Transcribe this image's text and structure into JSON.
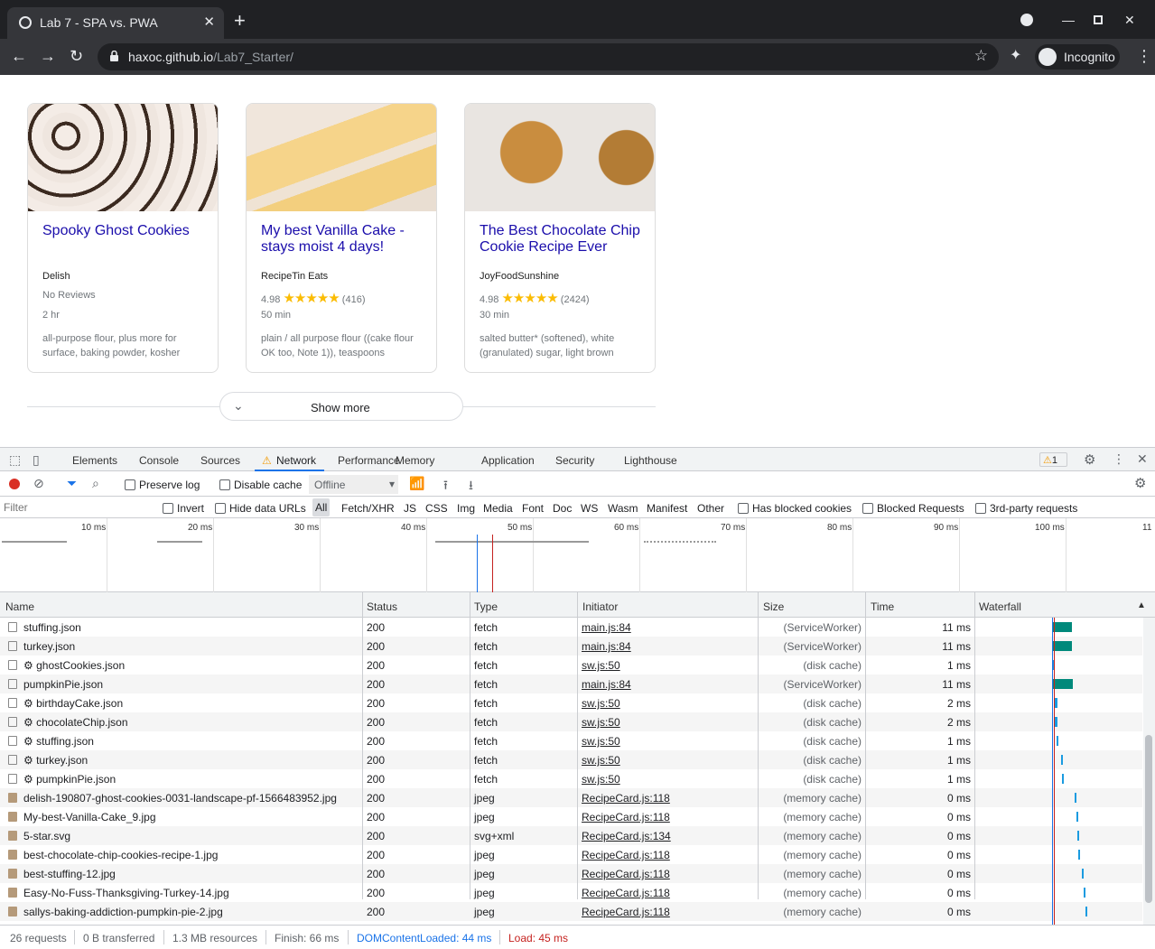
{
  "browser": {
    "tab_title": "Lab 7 - SPA vs. PWA",
    "url_host": "haxoc.github.io",
    "url_path": "/Lab7_Starter/",
    "incognito_label": "Incognito"
  },
  "page": {
    "cards": [
      {
        "title": "Spooky Ghost Cookies",
        "org": "Delish",
        "rating": "No Reviews",
        "stars": "",
        "count": "",
        "time": "2 hr",
        "ingredients": "all-purpose flour, plus more for surface, baking powder, kosher"
      },
      {
        "title": "My best Vanilla Cake - stays moist 4 days!",
        "org": "RecipeTin Eats",
        "rating": "4.98",
        "stars": "★★★★★",
        "count": "(416)",
        "time": "50 min",
        "ingredients": "plain / all purpose flour ((cake flour OK too, Note 1)), teaspoons"
      },
      {
        "title": "The Best Chocolate Chip Cookie Recipe Ever",
        "org": "JoyFoodSunshine",
        "rating": "4.98",
        "stars": "★★★★★",
        "count": "(2424)",
        "time": "30 min",
        "ingredients": "salted butter* (softened), white (granulated) sugar, light brown"
      }
    ],
    "show_more": "Show more"
  },
  "devtools": {
    "tabs": [
      "Elements",
      "Console",
      "Sources",
      "Network",
      "Performance",
      "Memory",
      "Application",
      "Security",
      "Lighthouse"
    ],
    "warning_count": "1",
    "preserve_log": "Preserve log",
    "disable_cache": "Disable cache",
    "throttle": "Offline",
    "filter_placeholder": "Filter",
    "invert": "Invert",
    "hide_data_urls": "Hide data URLs",
    "types": [
      "All",
      "Fetch/XHR",
      "JS",
      "CSS",
      "Img",
      "Media",
      "Font",
      "Doc",
      "WS",
      "Wasm",
      "Manifest",
      "Other"
    ],
    "has_blocked_cookies": "Has blocked cookies",
    "blocked_requests": "Blocked Requests",
    "third_party": "3rd-party requests",
    "timeline_labels": [
      "10 ms",
      "20 ms",
      "30 ms",
      "40 ms",
      "50 ms",
      "60 ms",
      "70 ms",
      "80 ms",
      "90 ms",
      "100 ms",
      "11"
    ],
    "columns": [
      "Name",
      "Status",
      "Type",
      "Initiator",
      "Size",
      "Time",
      "Waterfall"
    ],
    "rows": [
      {
        "name": "stuffing.json",
        "status": "200",
        "type": "fetch",
        "initiator": "main.js:84",
        "size": "(ServiceWorker)",
        "time": "11 ms"
      },
      {
        "name": "turkey.json",
        "status": "200",
        "type": "fetch",
        "initiator": "main.js:84",
        "size": "(ServiceWorker)",
        "time": "11 ms"
      },
      {
        "name": "⚙ ghostCookies.json",
        "status": "200",
        "type": "fetch",
        "initiator": "sw.js:50",
        "size": "(disk cache)",
        "time": "1 ms"
      },
      {
        "name": "pumpkinPie.json",
        "status": "200",
        "type": "fetch",
        "initiator": "main.js:84",
        "size": "(ServiceWorker)",
        "time": "11 ms"
      },
      {
        "name": "⚙ birthdayCake.json",
        "status": "200",
        "type": "fetch",
        "initiator": "sw.js:50",
        "size": "(disk cache)",
        "time": "2 ms"
      },
      {
        "name": "⚙ chocolateChip.json",
        "status": "200",
        "type": "fetch",
        "initiator": "sw.js:50",
        "size": "(disk cache)",
        "time": "2 ms"
      },
      {
        "name": "⚙ stuffing.json",
        "status": "200",
        "type": "fetch",
        "initiator": "sw.js:50",
        "size": "(disk cache)",
        "time": "1 ms"
      },
      {
        "name": "⚙ turkey.json",
        "status": "200",
        "type": "fetch",
        "initiator": "sw.js:50",
        "size": "(disk cache)",
        "time": "1 ms"
      },
      {
        "name": "⚙ pumpkinPie.json",
        "status": "200",
        "type": "fetch",
        "initiator": "sw.js:50",
        "size": "(disk cache)",
        "time": "1 ms"
      },
      {
        "name": "delish-190807-ghost-cookies-0031-landscape-pf-1566483952.jpg",
        "status": "200",
        "type": "jpeg",
        "initiator": "RecipeCard.js:118",
        "size": "(memory cache)",
        "time": "0 ms"
      },
      {
        "name": "My-best-Vanilla-Cake_9.jpg",
        "status": "200",
        "type": "jpeg",
        "initiator": "RecipeCard.js:118",
        "size": "(memory cache)",
        "time": "0 ms"
      },
      {
        "name": "5-star.svg",
        "status": "200",
        "type": "svg+xml",
        "initiator": "RecipeCard.js:134",
        "size": "(memory cache)",
        "time": "0 ms"
      },
      {
        "name": "best-chocolate-chip-cookies-recipe-1.jpg",
        "status": "200",
        "type": "jpeg",
        "initiator": "RecipeCard.js:118",
        "size": "(memory cache)",
        "time": "0 ms"
      },
      {
        "name": "best-stuffing-12.jpg",
        "status": "200",
        "type": "jpeg",
        "initiator": "RecipeCard.js:118",
        "size": "(memory cache)",
        "time": "0 ms"
      },
      {
        "name": "Easy-No-Fuss-Thanksgiving-Turkey-14.jpg",
        "status": "200",
        "type": "jpeg",
        "initiator": "RecipeCard.js:118",
        "size": "(memory cache)",
        "time": "0 ms"
      },
      {
        "name": "sallys-baking-addiction-pumpkin-pie-2.jpg",
        "status": "200",
        "type": "jpeg",
        "initiator": "RecipeCard.js:118",
        "size": "(memory cache)",
        "time": "0 ms"
      }
    ],
    "status": {
      "requests": "26 requests",
      "transferred": "0 B transferred",
      "resources": "1.3 MB resources",
      "finish": "Finish: 66 ms",
      "dcl": "DOMContentLoaded: 44 ms",
      "load": "Load: 45 ms"
    },
    "colors": {
      "dcl": "#1a73e8",
      "load": "#c5221f",
      "wf_sw": "#00897b",
      "wf_cache": "#1a9be0"
    }
  }
}
